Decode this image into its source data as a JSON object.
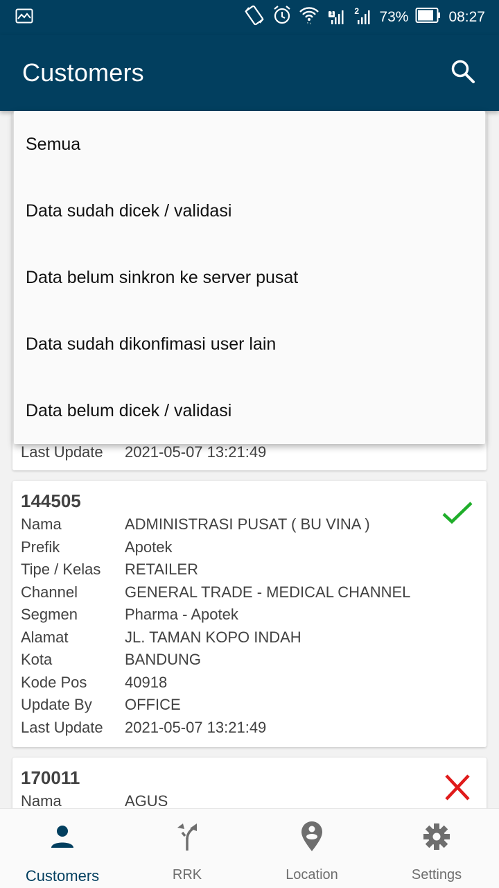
{
  "status_bar": {
    "battery_percent": "73%",
    "time": "08:27",
    "sim1_badge": "1",
    "sim2_badge": "2",
    "icons": [
      "image-icon",
      "vibrate-icon",
      "alarm-icon",
      "wifi-icon",
      "signal-sim1-icon",
      "signal-sim2-icon",
      "battery-icon"
    ]
  },
  "app_bar": {
    "title": "Customers",
    "search_icon": "search-icon"
  },
  "colors": {
    "primary": "#023f5f",
    "check_green": "#1fae2a",
    "cross_red": "#e01b1b",
    "inactive_gray": "#6e6e6e"
  },
  "filter_menu": {
    "options": [
      "Semua",
      "Data sudah dicek / validasi",
      "Data belum sinkron ke server pusat",
      "Data sudah dikonfimasi user lain",
      "Data belum dicek / validasi"
    ]
  },
  "customers": [
    {
      "visible_rows": [
        {
          "label": "Last Update",
          "value": "2021-05-07 13:21:49"
        }
      ]
    },
    {
      "code": "144505",
      "status": "validated",
      "rows": [
        {
          "label": "Nama",
          "value": "ADMINISTRASI PUSAT ( BU VINA )"
        },
        {
          "label": "Prefik",
          "value": "Apotek"
        },
        {
          "label": "Tipe / Kelas",
          "value": "RETAILER"
        },
        {
          "label": "Channel",
          "value": "GENERAL TRADE - MEDICAL CHANNEL"
        },
        {
          "label": "Segmen",
          "value": "Pharma - Apotek"
        },
        {
          "label": "Alamat",
          "value": "JL. TAMAN KOPO INDAH"
        },
        {
          "label": "Kota",
          "value": "BANDUNG"
        },
        {
          "label": "Kode Pos",
          "value": "40918"
        },
        {
          "label": "Update By",
          "value": "OFFICE"
        },
        {
          "label": "Last Update",
          "value": "2021-05-07 13:21:49"
        }
      ]
    },
    {
      "code": "170011",
      "status": "not-validated",
      "rows": [
        {
          "label": "Nama",
          "value": "AGUS"
        }
      ]
    }
  ],
  "bottom_nav": {
    "tabs": [
      {
        "label": "Customers",
        "icon": "person-icon",
        "active": true
      },
      {
        "label": "RRK",
        "icon": "fork-arrows-icon",
        "active": false
      },
      {
        "label": "Location",
        "icon": "location-pin-icon",
        "active": false
      },
      {
        "label": "Settings",
        "icon": "gear-icon",
        "active": false
      }
    ]
  }
}
